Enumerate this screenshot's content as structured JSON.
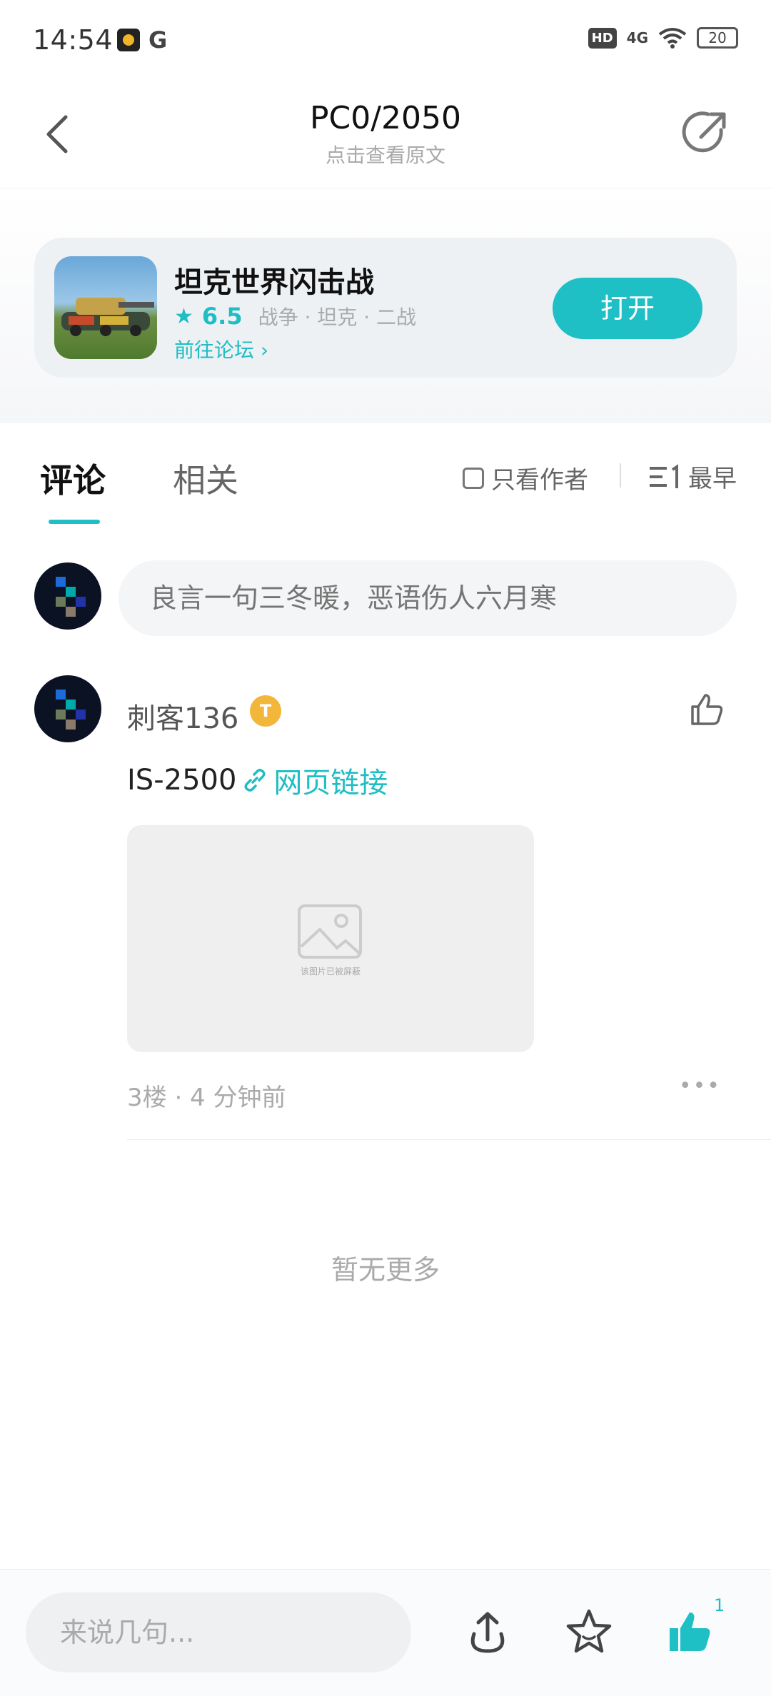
{
  "status_bar": {
    "time": "14:54",
    "app_letter": "G",
    "hd": "HD",
    "network": "4G",
    "battery": "20"
  },
  "nav": {
    "title": "PC0/2050",
    "subtitle": "点击查看原文"
  },
  "game_card": {
    "name": "坦克世界闪击战",
    "rating": "6.5",
    "tags": "战争 · 坦克 · 二战",
    "forum_link": "前往论坛",
    "open_button": "打开"
  },
  "tabs": {
    "comments": "评论",
    "related": "相关",
    "only_author": "只看作者",
    "sort": "最早"
  },
  "comment_input": {
    "placeholder": "良言一句三冬暖，恶语伤人六月寒"
  },
  "comment": {
    "username": "刺客136",
    "badge": "T",
    "text": "IS-2500",
    "link_text": "网页链接",
    "blocked_image_text": "该图片已被屏蔽",
    "meta": "3楼 · 4 分钟前",
    "more": "•••"
  },
  "no_more": "暂无更多",
  "bottom_bar": {
    "placeholder": "来说几句...",
    "like_count": "1"
  },
  "colors": {
    "accent": "#1fbfc6",
    "text_secondary": "#aaaaaa"
  }
}
